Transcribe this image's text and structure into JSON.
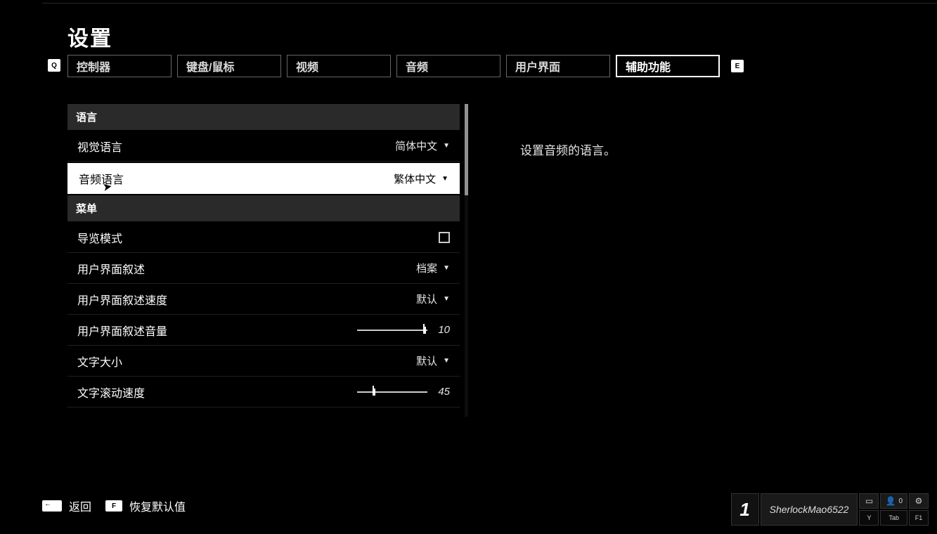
{
  "title": "设置",
  "tabs": {
    "left_key": "Q",
    "right_key": "E",
    "items": [
      {
        "label": "控制器"
      },
      {
        "label": "键盘/鼠标"
      },
      {
        "label": "视频"
      },
      {
        "label": "音频"
      },
      {
        "label": "用户界面"
      },
      {
        "label": "辅助功能"
      }
    ],
    "active_index": 5
  },
  "sections": [
    {
      "header": "语言",
      "rows": [
        {
          "type": "dropdown",
          "label": "视觉语言",
          "value": "简体中文"
        },
        {
          "type": "dropdown",
          "label": "音频语言",
          "value": "繁体中文",
          "selected": true
        }
      ]
    },
    {
      "header": "菜单",
      "rows": [
        {
          "type": "checkbox",
          "label": "导览模式",
          "checked": false
        },
        {
          "type": "dropdown",
          "label": "用户界面叙述",
          "value": "档案"
        },
        {
          "type": "dropdown",
          "label": "用户界面叙述速度",
          "value": "默认"
        },
        {
          "type": "slider",
          "label": "用户界面叙述音量",
          "value": 10,
          "min": 0,
          "max": 10
        },
        {
          "type": "dropdown",
          "label": "文字大小",
          "value": "默认"
        },
        {
          "type": "slider",
          "label": "文字滚动速度",
          "value": 45,
          "min": 0,
          "max": 100
        }
      ]
    }
  ],
  "description": "设置音频的语言。",
  "footer": {
    "back_key": "←",
    "back_label": "返回",
    "reset_key": "F",
    "reset_label": "恢复默认值"
  },
  "hud": {
    "rank": "1",
    "name": "SherlockMao6522",
    "party_count": "0",
    "chat_key": "Y",
    "party_key": "Tab",
    "settings_key": "F1"
  }
}
